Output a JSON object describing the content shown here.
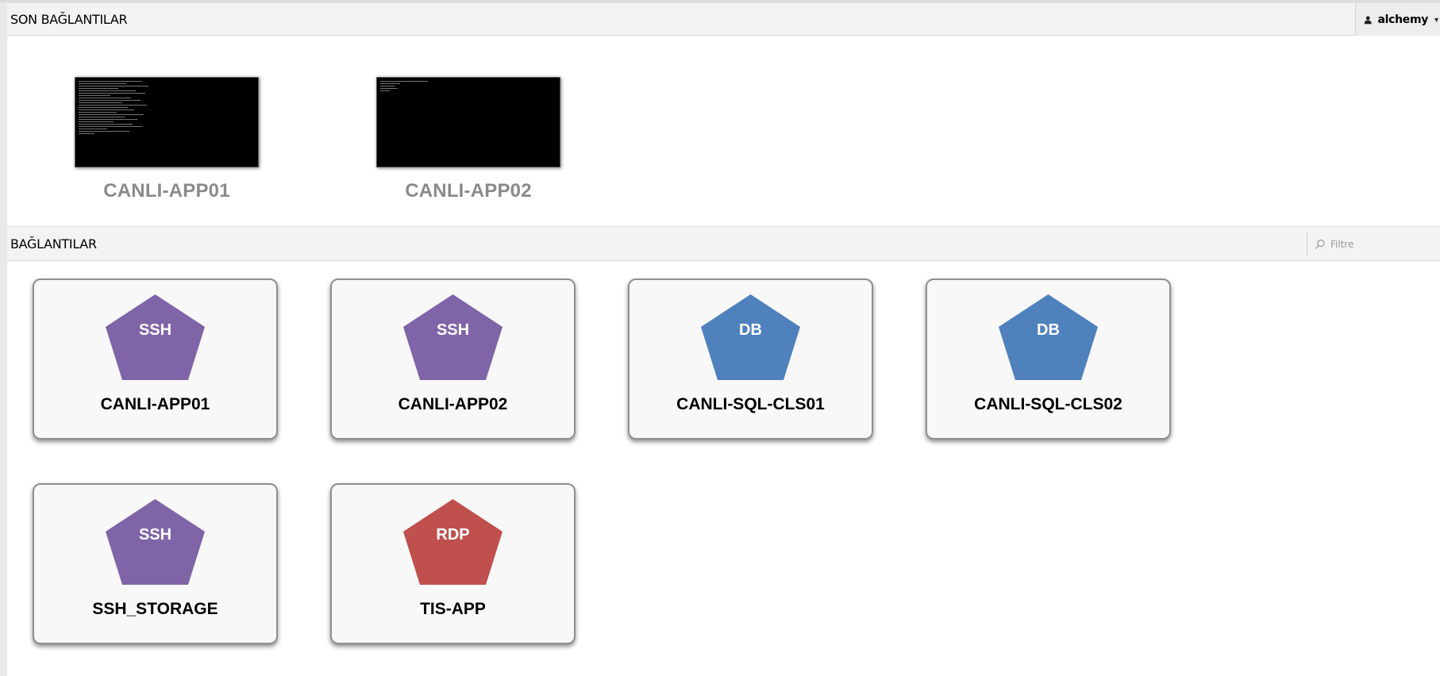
{
  "recent_section": {
    "title": "SON BAĞLANTILAR",
    "items": [
      {
        "name": "CANLI-APP01"
      },
      {
        "name": "CANLI-APP02"
      }
    ]
  },
  "user_menu": {
    "username": "alchemy",
    "icon": "user-icon"
  },
  "connections_section": {
    "title": "BAĞLANTILAR",
    "filter": {
      "placeholder": "Filtre",
      "value": "",
      "icon": "search-icon"
    },
    "cards": [
      {
        "name": "CANLI-APP01",
        "protocol": "SSH",
        "color": "#8064a8"
      },
      {
        "name": "CANLI-APP02",
        "protocol": "SSH",
        "color": "#8064a8"
      },
      {
        "name": "CANLI-SQL-CLS01",
        "protocol": "DB",
        "color": "#4f81bd"
      },
      {
        "name": "CANLI-SQL-CLS02",
        "protocol": "DB",
        "color": "#4f81bd"
      },
      {
        "name": "SSH_STORAGE",
        "protocol": "SSH",
        "color": "#8064a8"
      },
      {
        "name": "TIS-APP",
        "protocol": "RDP",
        "color": "#c0504d"
      }
    ]
  }
}
